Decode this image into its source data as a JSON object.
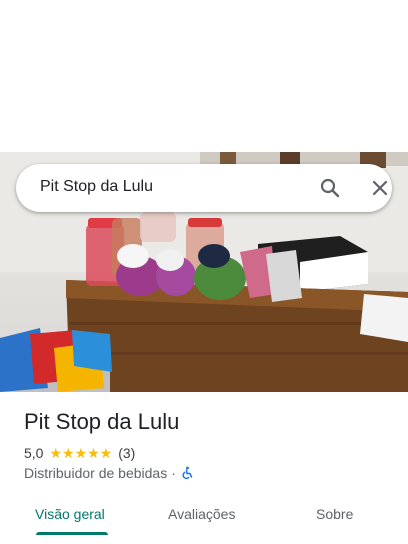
{
  "search": {
    "query": "Pit Stop da Lulu"
  },
  "place": {
    "title": "Pit Stop da Lulu",
    "rating": "5,0",
    "stars": "★★★★★",
    "reviews": "(3)",
    "category": "Distribuidor de bebidas",
    "separator": "·"
  },
  "tabs": [
    {
      "label": "Visão geral",
      "active": true
    },
    {
      "label": "Avaliações",
      "active": false
    },
    {
      "label": "Sobre",
      "active": false
    }
  ],
  "colors": {
    "accent": "#00796b",
    "star": "#fbbc04"
  }
}
